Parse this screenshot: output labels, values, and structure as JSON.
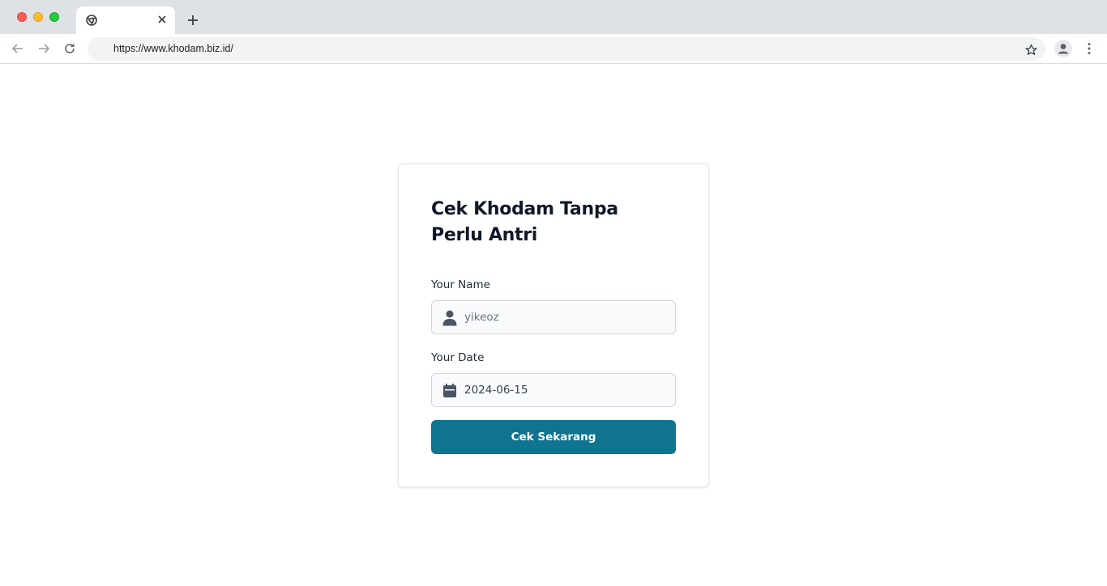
{
  "browser": {
    "tab_title": "",
    "url": "https://www.khodam.biz.id/",
    "icons": {
      "back": "arrow-left-icon",
      "forward": "arrow-right-icon",
      "reload": "reload-icon",
      "bookmark": "star-icon",
      "profile": "person-icon",
      "menu": "kebab-menu-icon",
      "favicon": "chrome-icon",
      "close_tab": "close-icon",
      "new_tab": "plus-icon"
    }
  },
  "form": {
    "title": "Cek Khodam Tanpa Perlu Antri",
    "name_label": "Your Name",
    "name_placeholder": "yikeoz",
    "name_value": "",
    "name_icon": "user-icon",
    "date_label": "Your Date",
    "date_value": "2024-06-15",
    "date_icon": "calendar-icon",
    "submit_label": "Cek Sekarang",
    "accent_color": "#0e7490"
  }
}
